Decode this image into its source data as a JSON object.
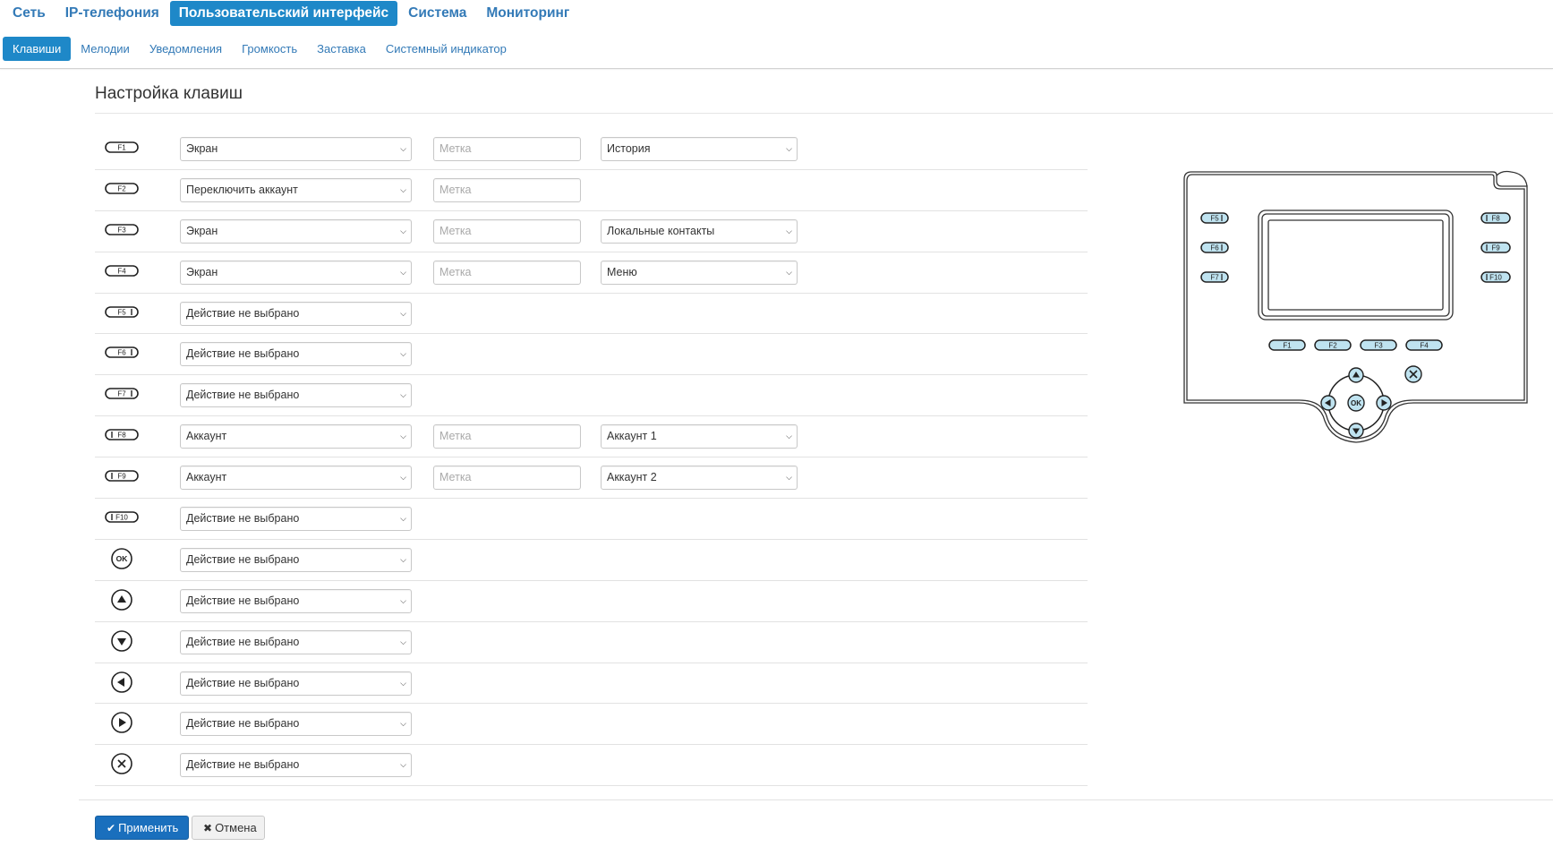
{
  "top_tabs": [
    {
      "label": "Сеть",
      "active": false
    },
    {
      "label": "IP-телефония",
      "active": false
    },
    {
      "label": "Пользовательский интерфейс",
      "active": true
    },
    {
      "label": "Система",
      "active": false
    },
    {
      "label": "Мониторинг",
      "active": false
    }
  ],
  "sub_tabs": [
    {
      "label": "Клавиши",
      "active": true
    },
    {
      "label": "Мелодии",
      "active": false
    },
    {
      "label": "Уведомления",
      "active": false
    },
    {
      "label": "Громкость",
      "active": false
    },
    {
      "label": "Заставка",
      "active": false
    },
    {
      "label": "Системный индикатор",
      "active": false
    }
  ],
  "page_title": "Настройка клавиш",
  "label_placeholder": "Метка",
  "rows": [
    {
      "key": "F1",
      "icon": "pill-key",
      "action": "Экран",
      "has_label": true,
      "param": "История"
    },
    {
      "key": "F2",
      "icon": "pill-key",
      "action": "Переключить аккаунт",
      "has_label": true,
      "param": ""
    },
    {
      "key": "F3",
      "icon": "pill-key",
      "action": "Экран",
      "has_label": true,
      "param": "Локальные контакты"
    },
    {
      "key": "F4",
      "icon": "pill-key",
      "action": "Экран",
      "has_label": true,
      "param": "Меню"
    },
    {
      "key": "F5",
      "icon": "pill-key-bar-right",
      "action": "Действие не выбрано",
      "has_label": false,
      "param": ""
    },
    {
      "key": "F6",
      "icon": "pill-key-bar-right",
      "action": "Действие не выбрано",
      "has_label": false,
      "param": ""
    },
    {
      "key": "F7",
      "icon": "pill-key-bar-right",
      "action": "Действие не выбрано",
      "has_label": false,
      "param": ""
    },
    {
      "key": "F8",
      "icon": "pill-key-bar-left",
      "action": "Аккаунт",
      "has_label": true,
      "param": "Аккаунт 1"
    },
    {
      "key": "F9",
      "icon": "pill-key-bar-left",
      "action": "Аккаунт",
      "has_label": true,
      "param": "Аккаунт 2"
    },
    {
      "key": "F10",
      "icon": "pill-key-bar-left",
      "action": "Действие не выбрано",
      "has_label": false,
      "param": ""
    },
    {
      "key": "OK",
      "icon": "ok-circle",
      "action": "Действие не выбрано",
      "has_label": false,
      "param": ""
    },
    {
      "key": "up",
      "icon": "arrow-up-circle",
      "action": "Действие не выбрано",
      "has_label": false,
      "param": ""
    },
    {
      "key": "down",
      "icon": "arrow-down-circle",
      "action": "Действие не выбрано",
      "has_label": false,
      "param": ""
    },
    {
      "key": "left",
      "icon": "arrow-left-circle",
      "action": "Действие не выбрано",
      "has_label": false,
      "param": ""
    },
    {
      "key": "right",
      "icon": "arrow-right-circle",
      "action": "Действие не выбрано",
      "has_label": false,
      "param": ""
    },
    {
      "key": "cancel",
      "icon": "x-circle",
      "action": "Действие не выбрано",
      "has_label": false,
      "param": ""
    }
  ],
  "phone_diagram": {
    "left_keys": [
      "F5",
      "F6",
      "F7"
    ],
    "right_keys": [
      "F8",
      "F9",
      "F10"
    ],
    "bottom_keys": [
      "F1",
      "F2",
      "F3",
      "F4"
    ],
    "ok_label": "OK"
  },
  "buttons": {
    "apply": "Применить",
    "cancel": "Отмена"
  },
  "colors": {
    "accent": "#1e88c8",
    "link": "#337ab7",
    "apply_button": "#1a6fbd",
    "key_highlight": "#bfe3f0"
  }
}
